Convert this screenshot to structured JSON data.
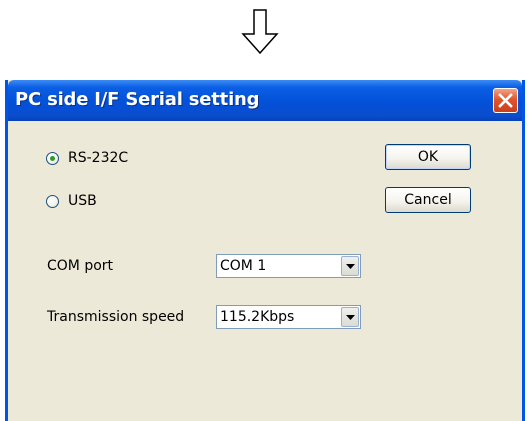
{
  "icons": {
    "down_arrow": "down-arrow-outline-icon",
    "close": "close-icon",
    "dropdown": "chevron-down-icon"
  },
  "colors": {
    "titlebar": "#0350d9",
    "close_button": "#e1552c",
    "dialog_background": "#ece9d8",
    "radio_selected": "#2d9a2a"
  },
  "dialog": {
    "title": "PC side I/F  Serial setting",
    "radios": [
      {
        "label": "RS-232C",
        "selected": true
      },
      {
        "label": "USB",
        "selected": false
      }
    ],
    "buttons": {
      "ok": "OK",
      "cancel": "Cancel"
    },
    "fields": {
      "com_port": {
        "label": "COM port",
        "value": "COM 1"
      },
      "speed": {
        "label": "Transmission speed",
        "value": "115.2Kbps"
      }
    }
  }
}
